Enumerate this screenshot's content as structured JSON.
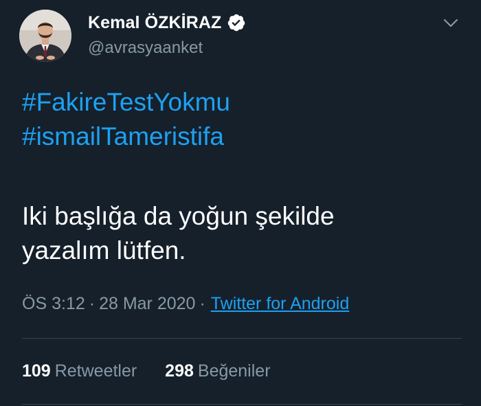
{
  "user": {
    "display_name": "Kemal ÖZKİRAZ",
    "handle": "@avrasyaanket",
    "verified": true
  },
  "tweet": {
    "hashtags": [
      "#FakireTestYokmu",
      "#ismailTameristifa"
    ],
    "message_lines": [
      "Iki başlığa da yoğun şekilde",
      "yazalım lütfen."
    ],
    "time": "ÖS 3:12",
    "separator": "·",
    "date": "28 Mar 2020",
    "source": "Twitter for Android"
  },
  "stats": {
    "retweets_count": "109",
    "retweets_label": "Retweetler",
    "likes_count": "298",
    "likes_label": "Beğeniler"
  },
  "colors": {
    "background": "#15202b",
    "link": "#1da1f2",
    "secondary_text": "#8899a6",
    "divider": "#38444d"
  },
  "icons": {
    "verified": "verified-badge-icon",
    "menu": "chevron-down-icon"
  }
}
